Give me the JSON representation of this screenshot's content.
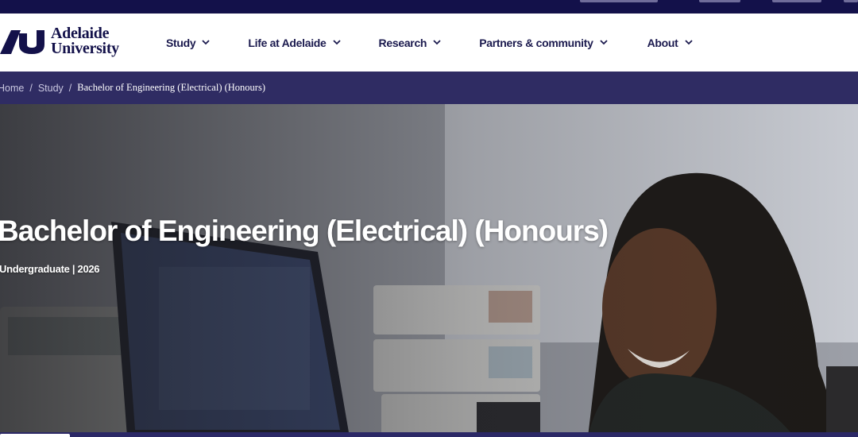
{
  "brand": {
    "name_line1": "Adelaide",
    "name_line2": "University",
    "primary_color": "#13114a",
    "nav_text_color": "#1b1a4e",
    "breadcrumb_bg": "#2f2c63"
  },
  "nav": {
    "items": [
      {
        "label": "Study",
        "icon": "chevron-down-icon"
      },
      {
        "label": "Life at Adelaide",
        "icon": "chevron-down-icon"
      },
      {
        "label": "Research",
        "icon": "chevron-down-icon"
      },
      {
        "label": "Partners & community",
        "icon": "chevron-down-icon"
      },
      {
        "label": "About",
        "icon": "chevron-down-icon"
      }
    ]
  },
  "breadcrumb": {
    "items": [
      "Home",
      "Study"
    ],
    "separator": "/",
    "current": "Bachelor of Engineering (Electrical) (Honours)"
  },
  "hero": {
    "title": "Bachelor of Engineering (Electrical) (Honours)",
    "subtitle": "Undergraduate | 2026"
  }
}
